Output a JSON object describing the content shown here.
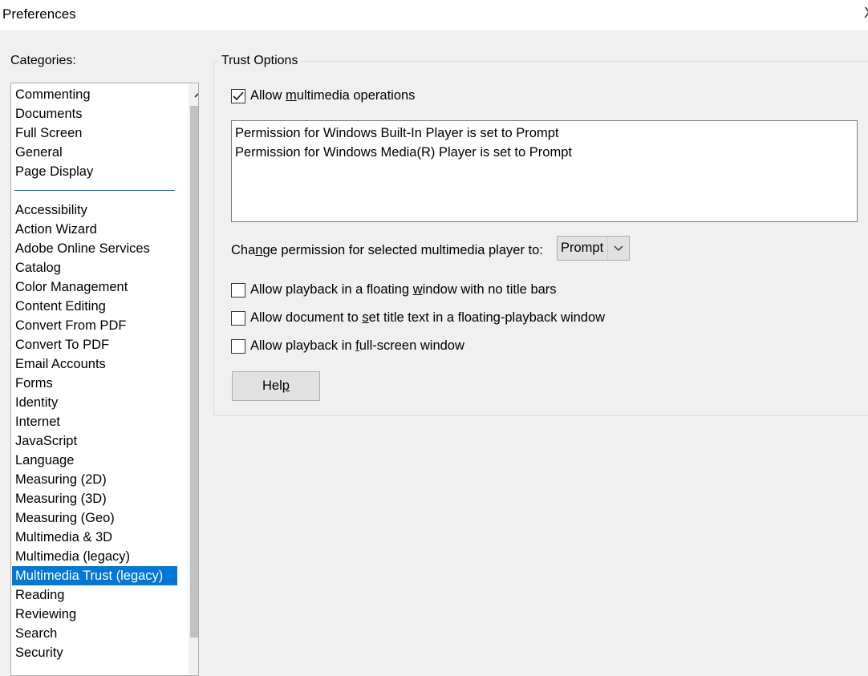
{
  "window": {
    "title": "Preferences",
    "close_glyph": "X"
  },
  "categories": {
    "label": "Categories:",
    "pinned_items": [
      "Commenting",
      "Documents",
      "Full Screen",
      "General",
      "Page Display"
    ],
    "items": [
      "Accessibility",
      "Action Wizard",
      "Adobe Online Services",
      "Catalog",
      "Color Management",
      "Content Editing",
      "Convert From PDF",
      "Convert To PDF",
      "Email Accounts",
      "Forms",
      "Identity",
      "Internet",
      "JavaScript",
      "Language",
      "Measuring (2D)",
      "Measuring (3D)",
      "Measuring (Geo)",
      "Multimedia & 3D",
      "Multimedia (legacy)",
      "Multimedia Trust (legacy)",
      "Reading",
      "Reviewing",
      "Search",
      "Security"
    ],
    "selected": "Multimedia Trust (legacy)"
  },
  "trust_options": {
    "group_label": "Trust Options",
    "allow_multimedia": {
      "label_before": "Allow ",
      "label_access": "m",
      "label_after": "ultimedia operations",
      "checked": true
    },
    "permissions_list": [
      "Permission for Windows Built-In Player is set to Prompt",
      "Permission for Windows Media(R) Player is set to Prompt"
    ],
    "change_permission": {
      "label_before": "Cha",
      "label_access": "n",
      "label_after": "ge permission for selected multimedia player to:",
      "selected_value": "Prompt"
    },
    "floating_no_title": {
      "label_before": "Allow playback in a floating ",
      "label_access": "w",
      "label_after": "indow with no title bars",
      "checked": false
    },
    "set_title_text": {
      "label_before": "Allow document to ",
      "label_access": "s",
      "label_after": "et title text in a floating-playback window",
      "checked": false
    },
    "full_screen": {
      "label_before": "Allow playback in ",
      "label_access": "f",
      "label_after": "ull-screen window",
      "checked": false
    },
    "help_button": {
      "label_before": "Hel",
      "label_access": "p",
      "label_after": ""
    }
  },
  "colors": {
    "selection": "#0078d7",
    "background": "#f0f0f0"
  },
  "icons": {
    "scroll_up": "chevron-up-icon",
    "select_arrow": "chevron-down-icon",
    "check": "checkmark-icon"
  }
}
